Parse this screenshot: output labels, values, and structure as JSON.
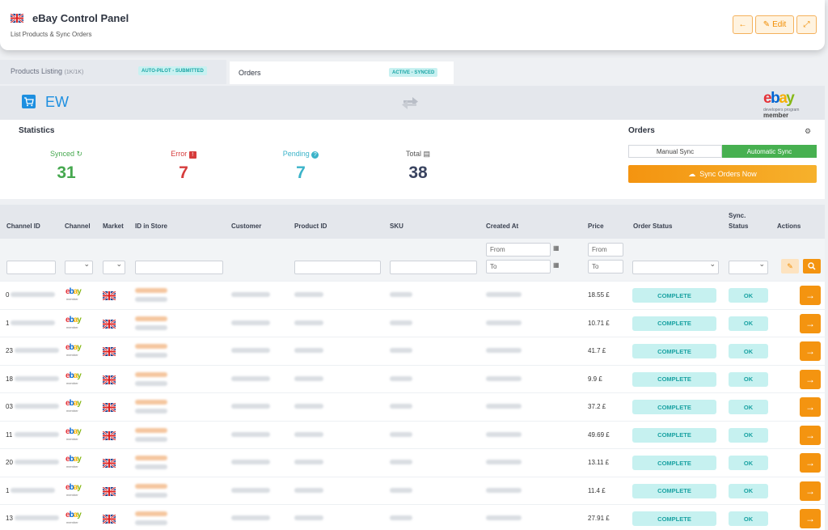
{
  "header": {
    "title": "eBay Control Panel",
    "subtitle": "List Products & Sync Orders",
    "back_icon": "←",
    "edit_label": "Edit",
    "edit_icon": "✎",
    "expand_icon": "⤢"
  },
  "tabs": [
    {
      "label": "Products Listing",
      "count": "(1K/1K)",
      "badge": "AUTO-PILOT - SUBMITTED"
    },
    {
      "label": "Orders",
      "badge": "ACTIVE - SYNCED"
    }
  ],
  "store": {
    "code": "EW",
    "cart_icon": "🛒",
    "sync_icon": "sync-arrows-icon"
  },
  "ebay_logo": {
    "e": "e",
    "b": "b",
    "a": "a",
    "y": "y",
    "sub": "developers program",
    "member": "member"
  },
  "statistics": {
    "title": "Statistics",
    "items": [
      {
        "label": "Synced",
        "icon": "↻",
        "value": "31",
        "color": "#46a84f"
      },
      {
        "label": "Error",
        "icon": "!",
        "value": "7",
        "color": "#d63c3c"
      },
      {
        "label": "Pending",
        "icon": "?",
        "value": "7",
        "color": "#3bb3c9"
      },
      {
        "label": "Total",
        "icon": "▤",
        "value": "38",
        "color": "#3a4460"
      }
    ]
  },
  "orders_panel": {
    "title": "Orders",
    "gear_icon": "⚙",
    "manual_label": "Manual Sync",
    "auto_label": "Automatic Sync",
    "sync_button": "Sync Orders Now",
    "sync_icon": "☁"
  },
  "table": {
    "columns": [
      "Channel ID",
      "Channel",
      "Market",
      "ID in Store",
      "Customer",
      "Product ID",
      "SKU",
      "Created At",
      "Price",
      "Order Status",
      "Sync.",
      "Status",
      "Actions"
    ],
    "filters": {
      "from_placeholder": "From",
      "to_placeholder": "To",
      "price_from": "From",
      "price_to": "To",
      "calendar_icon": "▦",
      "clear_icon": "✎",
      "search_icon": "🔍"
    },
    "rows": [
      {
        "id_prefix": "0",
        "price": "18.55 £",
        "status": "COMPLETE",
        "sync": "OK"
      },
      {
        "id_prefix": "1",
        "price": "10.71 £",
        "status": "COMPLETE",
        "sync": "OK"
      },
      {
        "id_prefix": "23",
        "price": "41.7 £",
        "status": "COMPLETE",
        "sync": "OK"
      },
      {
        "id_prefix": "18",
        "price": "9.9 £",
        "status": "COMPLETE",
        "sync": "OK"
      },
      {
        "id_prefix": "03",
        "price": "37.2 £",
        "status": "COMPLETE",
        "sync": "OK"
      },
      {
        "id_prefix": "11",
        "price": "49.69 £",
        "status": "COMPLETE",
        "sync": "OK"
      },
      {
        "id_prefix": "20",
        "price": "13.11 £",
        "status": "COMPLETE",
        "sync": "OK"
      },
      {
        "id_prefix": "1",
        "price": "11.4 £",
        "status": "COMPLETE",
        "sync": "OK"
      },
      {
        "id_prefix": "13",
        "price": "27.91 £",
        "status": "COMPLETE",
        "sync": "OK"
      }
    ],
    "row_action_icon": "→"
  },
  "colors": {
    "accent": "#f49410",
    "teal": "#1aa2a2",
    "green": "#47b050",
    "blue": "#1d8fe0"
  }
}
